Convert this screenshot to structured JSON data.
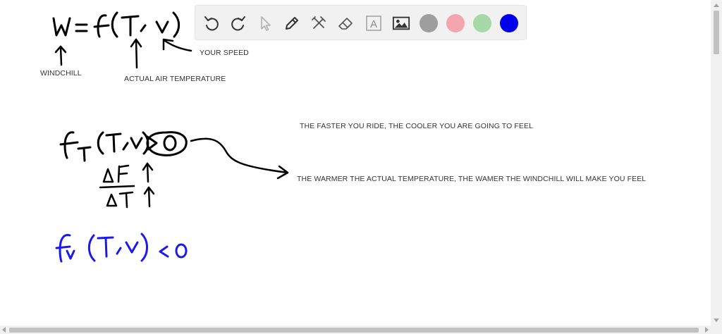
{
  "toolbar": {
    "tools": [
      {
        "name": "undo-icon"
      },
      {
        "name": "redo-icon"
      },
      {
        "name": "select-arrow-icon"
      },
      {
        "name": "pen-icon"
      },
      {
        "name": "tools-icon"
      },
      {
        "name": "eraser-icon"
      },
      {
        "name": "text-tool-icon",
        "glyph": "A"
      },
      {
        "name": "image-icon"
      }
    ],
    "colors": [
      {
        "name": "gray",
        "hex": "#9e9e9e"
      },
      {
        "name": "pink",
        "hex": "#f4a6ae"
      },
      {
        "name": "green",
        "hex": "#a6d8a8"
      },
      {
        "name": "blue",
        "hex": "#0000ee"
      }
    ]
  },
  "annotations": {
    "your_speed": "YOUR SPEED",
    "windchill": "WINDCHILL",
    "actual_air_temperature": "ACTUAL AIR TEMPERATURE",
    "faster_ride": "THE FASTER YOU RIDE, THE COOLER YOU ARE GOING TO FEEL",
    "warmer_temp": "THE WARMER THE ACTUAL TEMPERATURE, THE WAMER THE WINDCHILL WILL MAKE YOU FEEL"
  },
  "ink_colors": {
    "black": "#000000",
    "blue": "#1a1af0"
  }
}
